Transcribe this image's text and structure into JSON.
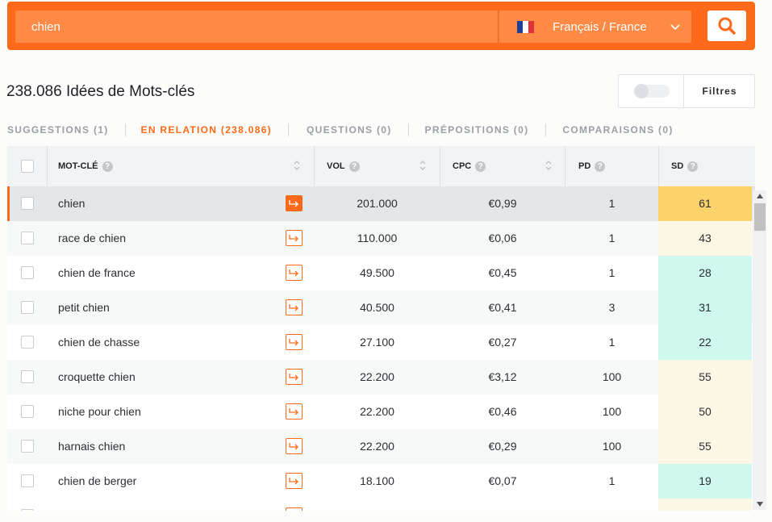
{
  "search": {
    "value": "chien",
    "language": "Français / France"
  },
  "results": {
    "title": "238.086 Idées de Mots-clés",
    "filters_label": "Filtres"
  },
  "tabs": [
    {
      "label": "SUGGESTIONS (1)",
      "active": false
    },
    {
      "label": "EN RELATION (238.086)",
      "active": true
    },
    {
      "label": "QUESTIONS (0)",
      "active": false
    },
    {
      "label": "PRÉPOSITIONS (0)",
      "active": false
    },
    {
      "label": "COMPARAISONS (0)",
      "active": false
    }
  ],
  "table": {
    "headers": {
      "keyword": "MOT-CLÉ",
      "vol": "VOL",
      "cpc": "CPC",
      "pd": "PD",
      "sd": "SD"
    },
    "rows": [
      {
        "keyword": "chien",
        "vol": "201.000",
        "cpc": "€0,99",
        "pd": "1",
        "sd": "61",
        "active": true
      },
      {
        "keyword": "race de chien",
        "vol": "110.000",
        "cpc": "€0,06",
        "pd": "1",
        "sd": "43"
      },
      {
        "keyword": "chien de france",
        "vol": "49.500",
        "cpc": "€0,45",
        "pd": "1",
        "sd": "28"
      },
      {
        "keyword": "petit chien",
        "vol": "40.500",
        "cpc": "€0,41",
        "pd": "3",
        "sd": "31"
      },
      {
        "keyword": "chien de chasse",
        "vol": "27.100",
        "cpc": "€0,27",
        "pd": "1",
        "sd": "22"
      },
      {
        "keyword": "croquette chien",
        "vol": "22.200",
        "cpc": "€3,12",
        "pd": "100",
        "sd": "55"
      },
      {
        "keyword": "niche pour chien",
        "vol": "22.200",
        "cpc": "€0,46",
        "pd": "100",
        "sd": "50"
      },
      {
        "keyword": "harnais chien",
        "vol": "22.200",
        "cpc": "€0,29",
        "pd": "100",
        "sd": "55"
      },
      {
        "keyword": "chien de berger",
        "vol": "18.100",
        "cpc": "€0,07",
        "pd": "1",
        "sd": "19"
      }
    ]
  },
  "colors": {
    "brand": "#ff6a1a",
    "sd_high": "#fcd36b",
    "sd_medium": "#fdf8e6",
    "sd_low": "#cff9ef"
  },
  "icons": {
    "search": "search-icon",
    "language": "french-flag-icon",
    "dropdown": "chevron-down-icon",
    "help": "help-icon",
    "sort": "sort-icon",
    "open_keyword": "arrow-right-icon"
  }
}
